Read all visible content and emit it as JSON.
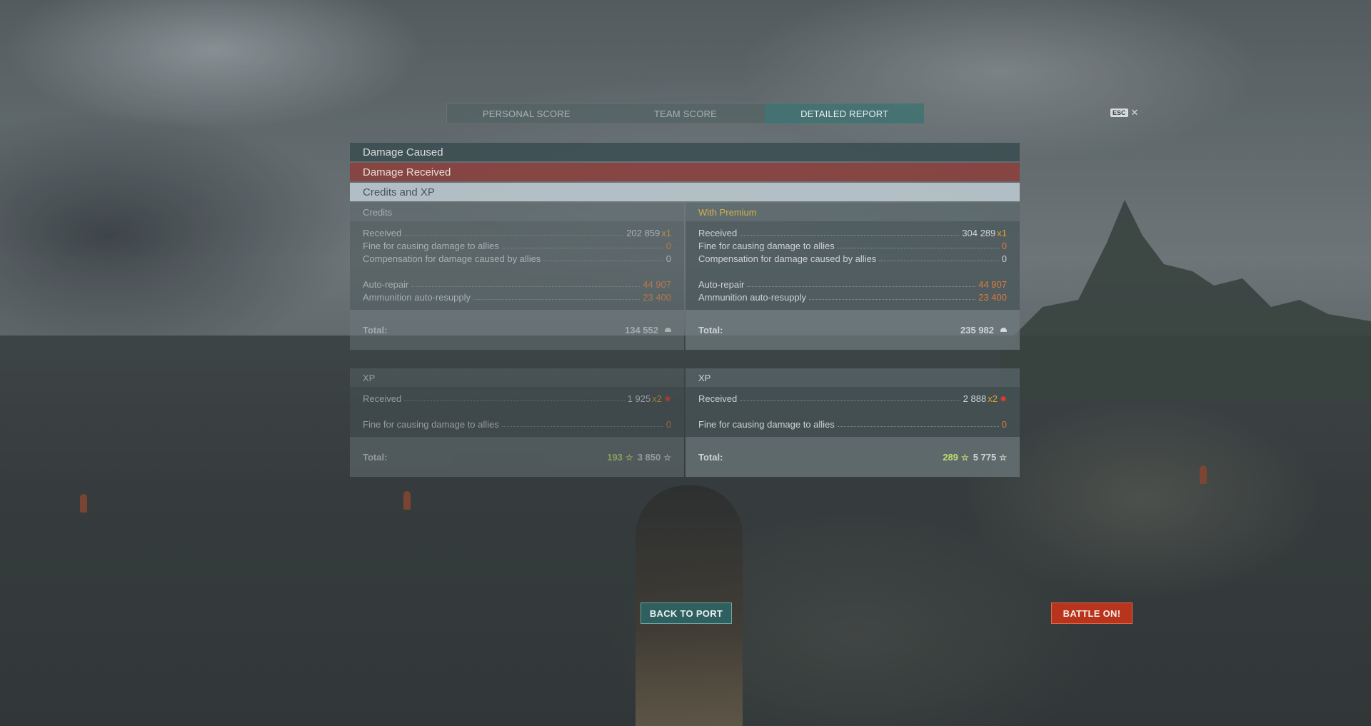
{
  "tabs": [
    {
      "label": "PERSONAL SCORE",
      "active": false
    },
    {
      "label": "TEAM SCORE",
      "active": false
    },
    {
      "label": "DETAILED REPORT",
      "active": true
    }
  ],
  "esc": {
    "key": "ESC",
    "close_glyph": "✕"
  },
  "sections": {
    "damage_caused": "Damage Caused",
    "damage_received": "Damage Received",
    "credits_xp": "Credits and XP"
  },
  "credits": {
    "standard": {
      "title": "Credits",
      "received": {
        "label": "Received",
        "value": "202 859",
        "mult": "x1"
      },
      "fine": {
        "label": "Fine for causing damage to allies",
        "value": "0"
      },
      "compensation": {
        "label": "Compensation for damage caused by allies",
        "value": "0"
      },
      "auto_repair": {
        "label": "Auto-repair",
        "value": "44 907"
      },
      "resupply": {
        "label": "Ammunition auto-resupply",
        "value": "23 400"
      },
      "total": {
        "label": "Total:",
        "value": "134 552"
      }
    },
    "premium": {
      "title": "With Premium",
      "received": {
        "label": "Received",
        "value": "304 289",
        "mult": "x1"
      },
      "fine": {
        "label": "Fine for causing damage to allies",
        "value": "0"
      },
      "compensation": {
        "label": "Compensation for damage caused by allies",
        "value": "0"
      },
      "auto_repair": {
        "label": "Auto-repair",
        "value": "44 907"
      },
      "resupply": {
        "label": "Ammunition auto-resupply",
        "value": "23 400"
      },
      "total": {
        "label": "Total:",
        "value": "235 982"
      }
    }
  },
  "xp": {
    "standard": {
      "title": "XP",
      "received": {
        "label": "Received",
        "value": "1 925",
        "mult": "x2"
      },
      "fine": {
        "label": "Fine for causing damage to allies",
        "value": "0"
      },
      "total": {
        "label": "Total:",
        "value_commander": "193",
        "value_ship": "3 850"
      }
    },
    "premium": {
      "title": "XP",
      "received": {
        "label": "Received",
        "value": "2 888",
        "mult": "x2"
      },
      "fine": {
        "label": "Fine for causing damage to allies",
        "value": "0"
      },
      "total": {
        "label": "Total:",
        "value_commander": "289",
        "value_ship": "5 775"
      }
    }
  },
  "buttons": {
    "back": "BACK TO PORT",
    "battle": "BATTLE ON!"
  },
  "icons": {
    "credits": "credits-icon",
    "elite_xp": "elite-xp-icon",
    "xp_star": "star-icon"
  },
  "colors": {
    "negative": "#e07a3a",
    "premium": "#d2b24a",
    "accent_teal": "#2f5f5f",
    "battle_red": "#b8341d"
  }
}
